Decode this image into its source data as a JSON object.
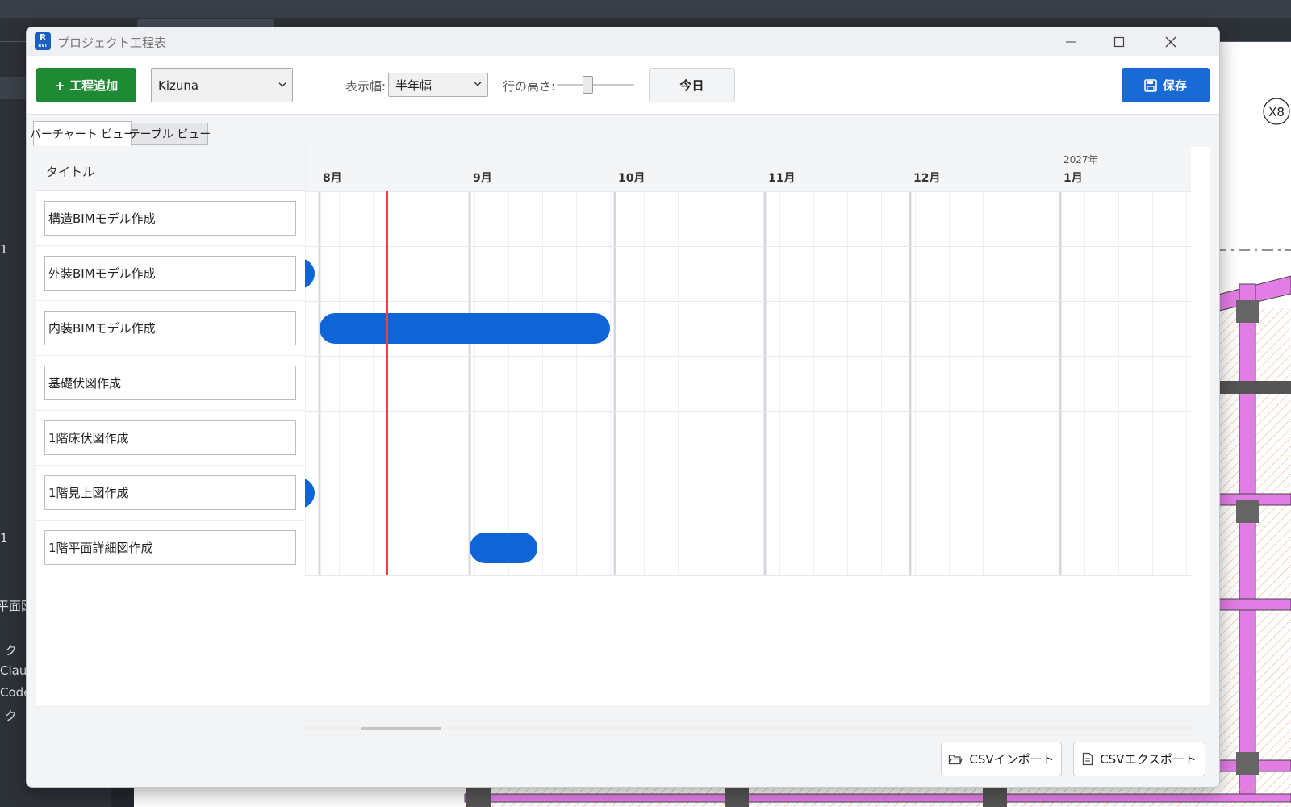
{
  "background": {
    "side_labels": [
      "1",
      "1",
      "平面図",
      "ク",
      "Claud",
      "Codex",
      "ク"
    ],
    "grid_bubble": "X8"
  },
  "window": {
    "title": "プロジェクト工程表",
    "icon_letter": "R",
    "icon_sub": "RVT"
  },
  "toolbar": {
    "add_label": "工程追加",
    "project_value": "Kizuna",
    "range_label": "表示幅:",
    "range_value": "半年幅",
    "row_height_label": "行の高さ:",
    "row_height_value": 0.38,
    "today_label": "今日",
    "save_label": "保存"
  },
  "tabs": {
    "bar_chart": "バーチャート ビュー",
    "table": "テーブル ビュー"
  },
  "grid": {
    "title_header": "タイトル",
    "rows": [
      "構造BIMモデル作成",
      "外装BIMモデル作成",
      "内装BIMモデル作成",
      "基礎伏図作成",
      "1階床伏図作成",
      "1階見上図作成",
      "1階平面詳細図作成"
    ]
  },
  "timeline": {
    "year_label": "2027年",
    "months": [
      "8月",
      "9月",
      "10月",
      "11月",
      "12月",
      "1月"
    ],
    "start_date": "2026-07-29",
    "today": "2026-08-15",
    "bars": [
      {
        "row": 1,
        "start": "2026-07-01",
        "end": "2026-07-31"
      },
      {
        "row": 2,
        "start": "2026-08-01",
        "end": "2026-09-30"
      },
      {
        "row": 5,
        "start": "2026-07-01",
        "end": "2026-07-31"
      },
      {
        "row": 6,
        "start": "2026-09-01",
        "end": "2026-09-15"
      }
    ],
    "bar_color": "#0f64d6",
    "today_color": "#e04545"
  },
  "footer": {
    "import_label": "CSVインポート",
    "export_label": "CSVエクスポート"
  }
}
